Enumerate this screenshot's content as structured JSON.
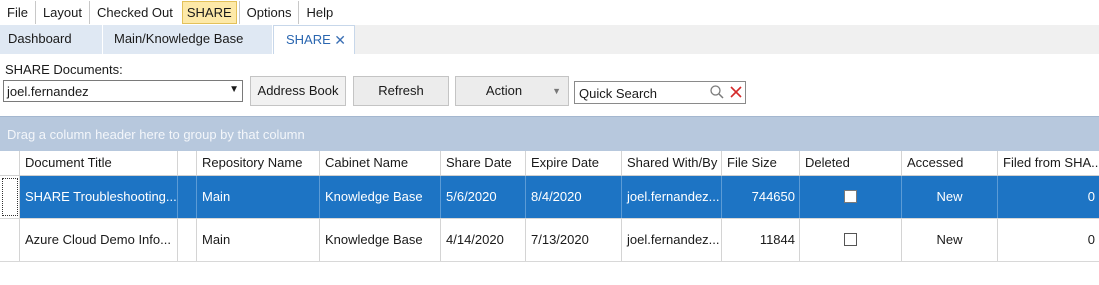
{
  "menu": {
    "items": [
      {
        "label": "File"
      },
      {
        "label": "Layout"
      },
      {
        "label": "Checked Out"
      },
      {
        "label": "SHARE",
        "active": true
      },
      {
        "label": "Options"
      },
      {
        "label": "Help"
      }
    ]
  },
  "tabs": [
    {
      "label": "Dashboard"
    },
    {
      "label": "Main/Knowledge Base"
    },
    {
      "label": "SHARE",
      "active": true,
      "close": "✕"
    }
  ],
  "toolbar": {
    "docs_label": "SHARE Documents:",
    "user_select_value": "joel.fernandez",
    "address_book_label": "Address Book",
    "refresh_label": "Refresh",
    "action_label": "Action",
    "search_placeholder": "Quick Search"
  },
  "grid": {
    "group_hint": "Drag a column header here to group by that column",
    "columns": [
      "Document Title",
      "Repository Name",
      "Cabinet Name",
      "Share Date",
      "Expire Date",
      "Shared With/By",
      "File Size",
      "Deleted",
      "Accessed",
      "Filed from SHA..."
    ],
    "rows": [
      {
        "title": "SHARE Troubleshooting...",
        "repository": "Main",
        "cabinet": "Knowledge Base",
        "share_date": "5/6/2020",
        "expire_date": "8/4/2020",
        "shared_with": "joel.fernandez...",
        "file_size": "744650",
        "deleted": false,
        "accessed": "New",
        "filed_from": "0",
        "selected": true
      },
      {
        "title": "Azure Cloud Demo Info...",
        "repository": "Main",
        "cabinet": "Knowledge Base",
        "share_date": "4/14/2020",
        "expire_date": "7/13/2020",
        "shared_with": "joel.fernandez...",
        "file_size": "11844",
        "deleted": false,
        "accessed": "New",
        "filed_from": "0",
        "selected": false
      }
    ]
  },
  "colors": {
    "selection": "#1d74c4",
    "group_panel": "#b7c8dd",
    "active_menu": "#fde9a8"
  }
}
